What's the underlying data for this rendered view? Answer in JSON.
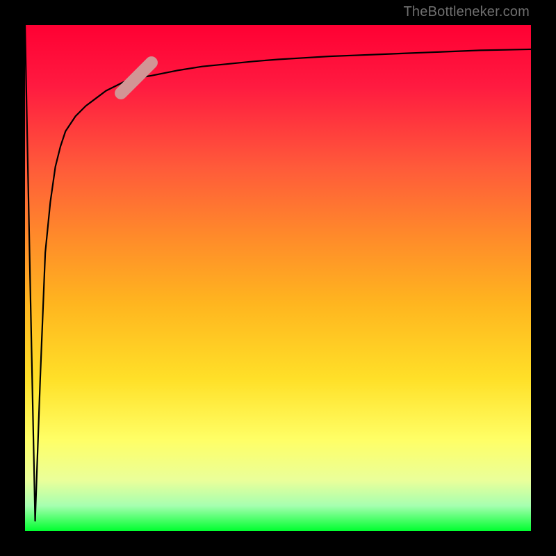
{
  "attribution": "TheBottleneker.com",
  "colors": {
    "frame": "#000000",
    "curve": "#000000",
    "marker": "#d29595",
    "gradient_top": "#ff0033",
    "gradient_bottom": "#00ff2f"
  },
  "chart_data": {
    "type": "line",
    "title": "",
    "xlabel": "",
    "ylabel": "",
    "xlim": [
      0,
      100
    ],
    "ylim": [
      0,
      100
    ],
    "grid": false,
    "legend": false,
    "x": [
      0,
      1,
      2,
      3,
      4,
      5,
      6,
      7,
      8,
      10,
      12,
      14,
      16,
      18,
      20,
      22,
      25,
      30,
      35,
      40,
      45,
      50,
      55,
      60,
      65,
      70,
      75,
      80,
      85,
      90,
      95,
      100
    ],
    "y": [
      100,
      50,
      2,
      30,
      55,
      65,
      72,
      76,
      79,
      82,
      84,
      85.5,
      87,
      88,
      89,
      89.5,
      90,
      91,
      91.8,
      92.3,
      92.8,
      93.2,
      93.5,
      93.8,
      94.0,
      94.2,
      94.4,
      94.6,
      94.8,
      95.0,
      95.1,
      95.2
    ],
    "marker": {
      "x": 22,
      "y": 89.5,
      "angle_deg": -45,
      "length_frac": 0.11
    },
    "notes": "y-axis inverted visually: 0 at top, 100 at bottom (green). Curve read off an unlabeled plot; values approximate."
  }
}
